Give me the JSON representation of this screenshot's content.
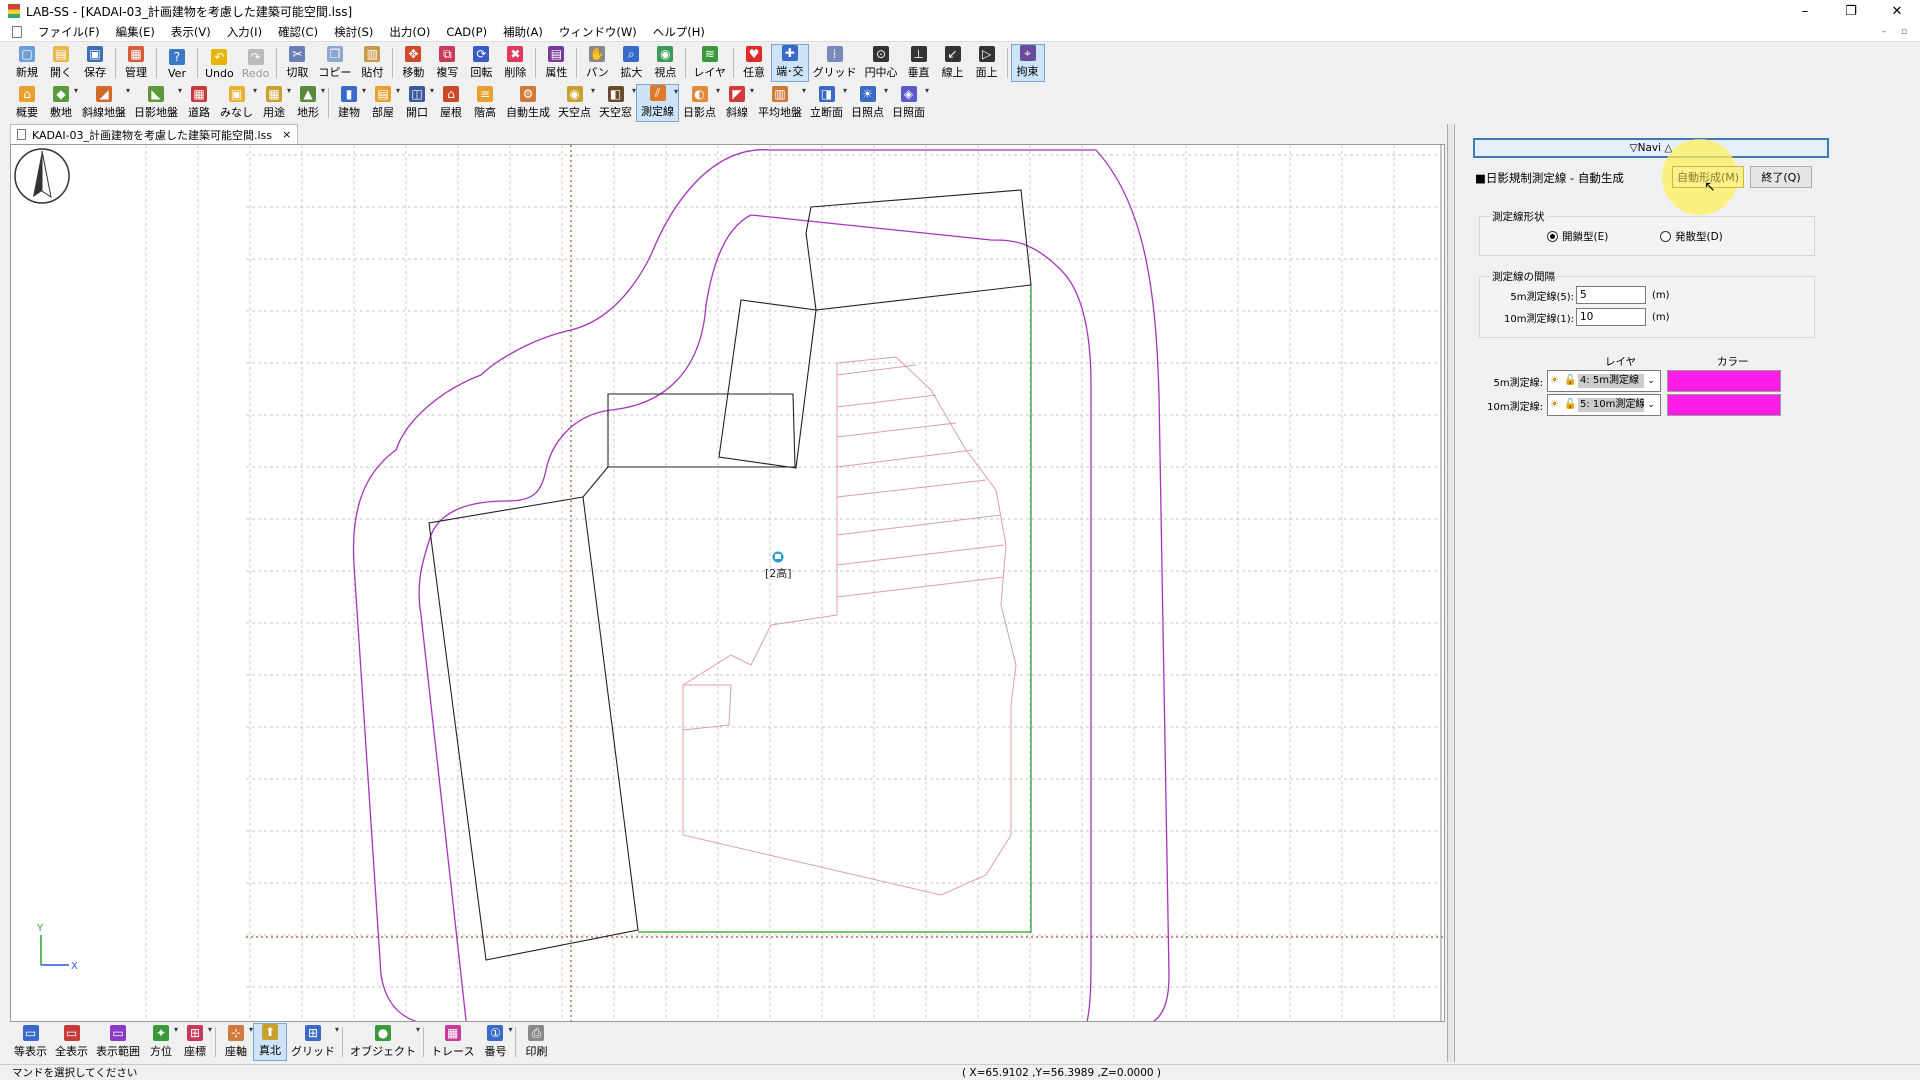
{
  "window": {
    "title": "LAB-SS - [KADAI-03_計画建物を考慮した建築可能空間.lss]",
    "minimize": "–",
    "restore": "❐",
    "close": "✕"
  },
  "menu": [
    "ファイル(F)",
    "編集(E)",
    "表示(V)",
    "入力(I)",
    "確認(C)",
    "検討(S)",
    "出力(O)",
    "CAD(P)",
    "補助(A)",
    "ウィンドウ(W)",
    "ヘルプ(H)"
  ],
  "mdi": {
    "minimize": "–",
    "restore": "▫"
  },
  "toolbar1": [
    {
      "label": "新規",
      "icon": "new-icon",
      "color": "#6a9fd8",
      "glyph": "▢"
    },
    {
      "label": "開く",
      "icon": "open-icon",
      "color": "#e8b84a",
      "glyph": "▤"
    },
    {
      "label": "保存",
      "icon": "save-icon",
      "color": "#3c6fb4",
      "glyph": "▣"
    },
    {
      "label": "管理",
      "icon": "manage-icon",
      "color": "#d85a3a",
      "glyph": "▦",
      "sep_before": true
    },
    {
      "label": "Ver",
      "icon": "version-icon",
      "color": "#3a78c8",
      "glyph": "?",
      "sep_before": true
    },
    {
      "label": "Undo",
      "icon": "undo-icon",
      "color": "#e8b400",
      "glyph": "↶",
      "sep_before": true
    },
    {
      "label": "Redo",
      "icon": "redo-icon",
      "color": "#bbbbbb",
      "glyph": "↷",
      "disabled": true
    },
    {
      "label": "切取",
      "icon": "cut-icon",
      "color": "#6a7fb8",
      "glyph": "✂",
      "sep_before": true
    },
    {
      "label": "コピー",
      "icon": "copy-icon",
      "color": "#8fa8d0",
      "glyph": "❐"
    },
    {
      "label": "貼付",
      "icon": "paste-icon",
      "color": "#c89a4a",
      "glyph": "▥"
    },
    {
      "label": "移動",
      "icon": "move-icon",
      "color": "#d04a2a",
      "glyph": "✥",
      "sep_before": true
    },
    {
      "label": "複写",
      "icon": "duplicate-icon",
      "color": "#c83a5a",
      "glyph": "⧉"
    },
    {
      "label": "回転",
      "icon": "rotate-icon",
      "color": "#3a5ac8",
      "glyph": "⟳"
    },
    {
      "label": "削除",
      "icon": "delete-icon",
      "color": "#e03a5a",
      "glyph": "✖"
    },
    {
      "label": "属性",
      "icon": "attribute-icon",
      "color": "#7a3a9a",
      "glyph": "▤",
      "sep_before": true
    },
    {
      "label": "パン",
      "icon": "pan-icon",
      "color": "#888888",
      "glyph": "✋",
      "sep_before": true
    },
    {
      "label": "拡大",
      "icon": "zoom-icon",
      "color": "#3a6ac8",
      "glyph": "⌕"
    },
    {
      "label": "視点",
      "icon": "viewpoint-icon",
      "color": "#3a9a5a",
      "glyph": "◉"
    },
    {
      "label": "レイヤ",
      "icon": "layer-icon",
      "color": "#3a9a3a",
      "glyph": "≋",
      "sep_before": true
    },
    {
      "label": "任意",
      "icon": "free-point-icon",
      "color": "#e02a2a",
      "glyph": "♥",
      "sep_before": true
    },
    {
      "label": "端･交",
      "icon": "endpoint-icon",
      "color": "#3a6ac8",
      "glyph": "✚",
      "active": true
    },
    {
      "label": "グリッド",
      "icon": "grid-snap-icon",
      "color": "#7a8ab8",
      "glyph": "⁞"
    },
    {
      "label": "円中心",
      "icon": "circle-center-icon",
      "color": "#333333",
      "glyph": "⊙"
    },
    {
      "label": "垂直",
      "icon": "perpendicular-icon",
      "color": "#333333",
      "glyph": "⊥"
    },
    {
      "label": "線上",
      "icon": "on-line-icon",
      "color": "#333333",
      "glyph": "↙"
    },
    {
      "label": "面上",
      "icon": "on-face-icon",
      "color": "#333333",
      "glyph": "▷"
    },
    {
      "label": "拘束",
      "icon": "constraint-icon",
      "color": "#6a4a9a",
      "glyph": "⌖",
      "active": true,
      "sep_before": true
    }
  ],
  "toolbar2": [
    {
      "label": "概要",
      "icon": "overview-icon",
      "color": "#e8a030",
      "glyph": "⌂"
    },
    {
      "label": "敷地",
      "icon": "site-icon",
      "color": "#5a9a3a",
      "glyph": "◆",
      "dropdown": true
    },
    {
      "label": "斜線地盤",
      "icon": "slant-ground-icon",
      "color": "#d06a2a",
      "glyph": "◢",
      "dropdown": true
    },
    {
      "label": "日影地盤",
      "icon": "shadow-ground-icon",
      "color": "#5a9a3a",
      "glyph": "◣",
      "dropdown": true
    },
    {
      "label": "道路",
      "icon": "road-icon",
      "color": "#c83a3a",
      "glyph": "▦"
    },
    {
      "label": "みなし",
      "icon": "deemed-icon",
      "color": "#e8b030",
      "glyph": "▣",
      "dropdown": true
    },
    {
      "label": "用途",
      "icon": "usage-icon",
      "color": "#c8a030",
      "glyph": "▦",
      "dropdown": true
    },
    {
      "label": "地形",
      "icon": "terrain-icon",
      "color": "#5a8a3a",
      "glyph": "▲",
      "dropdown": true
    },
    {
      "label": "建物",
      "icon": "building-icon",
      "color": "#3a6ac8",
      "glyph": "▮",
      "dropdown": true,
      "sep_before": true
    },
    {
      "label": "部屋",
      "icon": "room-icon",
      "color": "#e8a030",
      "glyph": "▤",
      "dropdown": true
    },
    {
      "label": "開口",
      "icon": "opening-icon",
      "color": "#3a5a9a",
      "glyph": "◫",
      "dropdown": true
    },
    {
      "label": "屋根",
      "icon": "roof-icon",
      "color": "#c84a2a",
      "glyph": "⌂"
    },
    {
      "label": "階高",
      "icon": "floor-height-icon",
      "color": "#e8a030",
      "glyph": "≡"
    },
    {
      "label": "自動生成",
      "icon": "auto-generate-icon",
      "color": "#d07a3a",
      "glyph": "⚙"
    },
    {
      "label": "天空点",
      "icon": "sky-point-icon",
      "color": "#c8a030",
      "glyph": "◉",
      "dropdown": true
    },
    {
      "label": "天空窓",
      "icon": "sky-window-icon",
      "color": "#6a4a2a",
      "glyph": "◧",
      "dropdown": true
    },
    {
      "label": "測定線",
      "icon": "measure-line-icon",
      "color": "#e07a2a",
      "glyph": "⫽",
      "dropdown": true,
      "active": true
    },
    {
      "label": "日影点",
      "icon": "shadow-point-icon",
      "color": "#e08a3a",
      "glyph": "◐",
      "dropdown": true
    },
    {
      "label": "斜線",
      "icon": "slant-line-icon",
      "color": "#d03a3a",
      "glyph": "◤",
      "dropdown": true
    },
    {
      "label": "平均地盤",
      "icon": "average-ground-icon",
      "color": "#d07a3a",
      "glyph": "▥",
      "dropdown": true
    },
    {
      "label": "立断面",
      "icon": "section-icon",
      "color": "#3a6ac8",
      "glyph": "◨",
      "dropdown": true
    },
    {
      "label": "日照点",
      "icon": "sunlight-point-icon",
      "color": "#3a6ac8",
      "glyph": "☀",
      "dropdown": true
    },
    {
      "label": "日照面",
      "icon": "sunlight-face-icon",
      "color": "#5a5ac8",
      "glyph": "◈",
      "dropdown": true
    }
  ],
  "tab": {
    "label": "KADAI-03_計画建物を考慮した建築可能空間.lss",
    "close": "×"
  },
  "canvas": {
    "building_label": "[2高]",
    "axis_y": "Y",
    "axis_x": "X"
  },
  "bottombar": [
    {
      "label": "等表示",
      "icon": "display-icon",
      "color": "#3a6ac8",
      "glyph": "▭"
    },
    {
      "label": "全表示",
      "icon": "show-all-icon",
      "color": "#c83a3a",
      "glyph": "▭"
    },
    {
      "label": "表示範囲",
      "icon": "display-range-icon",
      "color": "#8a3ac8",
      "glyph": "▭"
    },
    {
      "label": "方位",
      "icon": "orientation-icon",
      "color": "#3a9a3a",
      "glyph": "✦",
      "dropdown": true
    },
    {
      "label": "座標",
      "icon": "coordinate-icon",
      "color": "#c83a5a",
      "glyph": "⊞",
      "dropdown": true
    },
    {
      "label": "座軸",
      "icon": "axis-icon",
      "color": "#d07a3a",
      "glyph": "⊹",
      "dropdown": true,
      "sep_before": true
    },
    {
      "label": "真北",
      "icon": "true-north-icon",
      "color": "#c8a030",
      "glyph": "⬆",
      "active": true
    },
    {
      "label": "グリッド",
      "icon": "grid-icon",
      "color": "#3a6ac8",
      "glyph": "⊞",
      "dropdown": true
    },
    {
      "label": "オブジェクト",
      "icon": "object-icon",
      "color": "#3a9a3a",
      "glyph": "●",
      "dropdown": true,
      "sep_before": true
    },
    {
      "label": "トレース",
      "icon": "trace-icon",
      "color": "#c83a9a",
      "glyph": "▦",
      "sep_before": true
    },
    {
      "label": "番号",
      "icon": "number-icon",
      "color": "#3a6ac8",
      "glyph": "①",
      "dropdown": true
    },
    {
      "label": "印刷",
      "icon": "print-icon",
      "color": "#8a8a8a",
      "glyph": "⎙",
      "sep_before": true
    }
  ],
  "status": {
    "message": "マンドを選択してください",
    "coords": "( X=65.9102 ,Y=56.3989 ,Z=0.0000 )"
  },
  "navi": {
    "header": "▽Navi △",
    "title": "■日影規制測定線 - 自動生成",
    "auto_button": "自動形成(M)",
    "end_button": "終了(Q)",
    "shape_group": {
      "label": "測定線形状",
      "closed": "開鎖型(E)",
      "open": "発散型(D)",
      "selected": "closed"
    },
    "interval_group": {
      "label": "測定線の間隔",
      "five_label": "5m測定線(5):",
      "five_value": "5",
      "ten_label": "10m測定線(1):",
      "ten_value": "10",
      "unit": "(m)"
    },
    "layer_header": "レイヤ",
    "color_header": "カラー",
    "rows": [
      {
        "label": "5m測定線:",
        "layer": "4: 5m測定線",
        "color": "#ff1ee8"
      },
      {
        "label": "10m測定線:",
        "layer": "5: 10m測定線",
        "color": "#ff1ee8"
      }
    ]
  }
}
